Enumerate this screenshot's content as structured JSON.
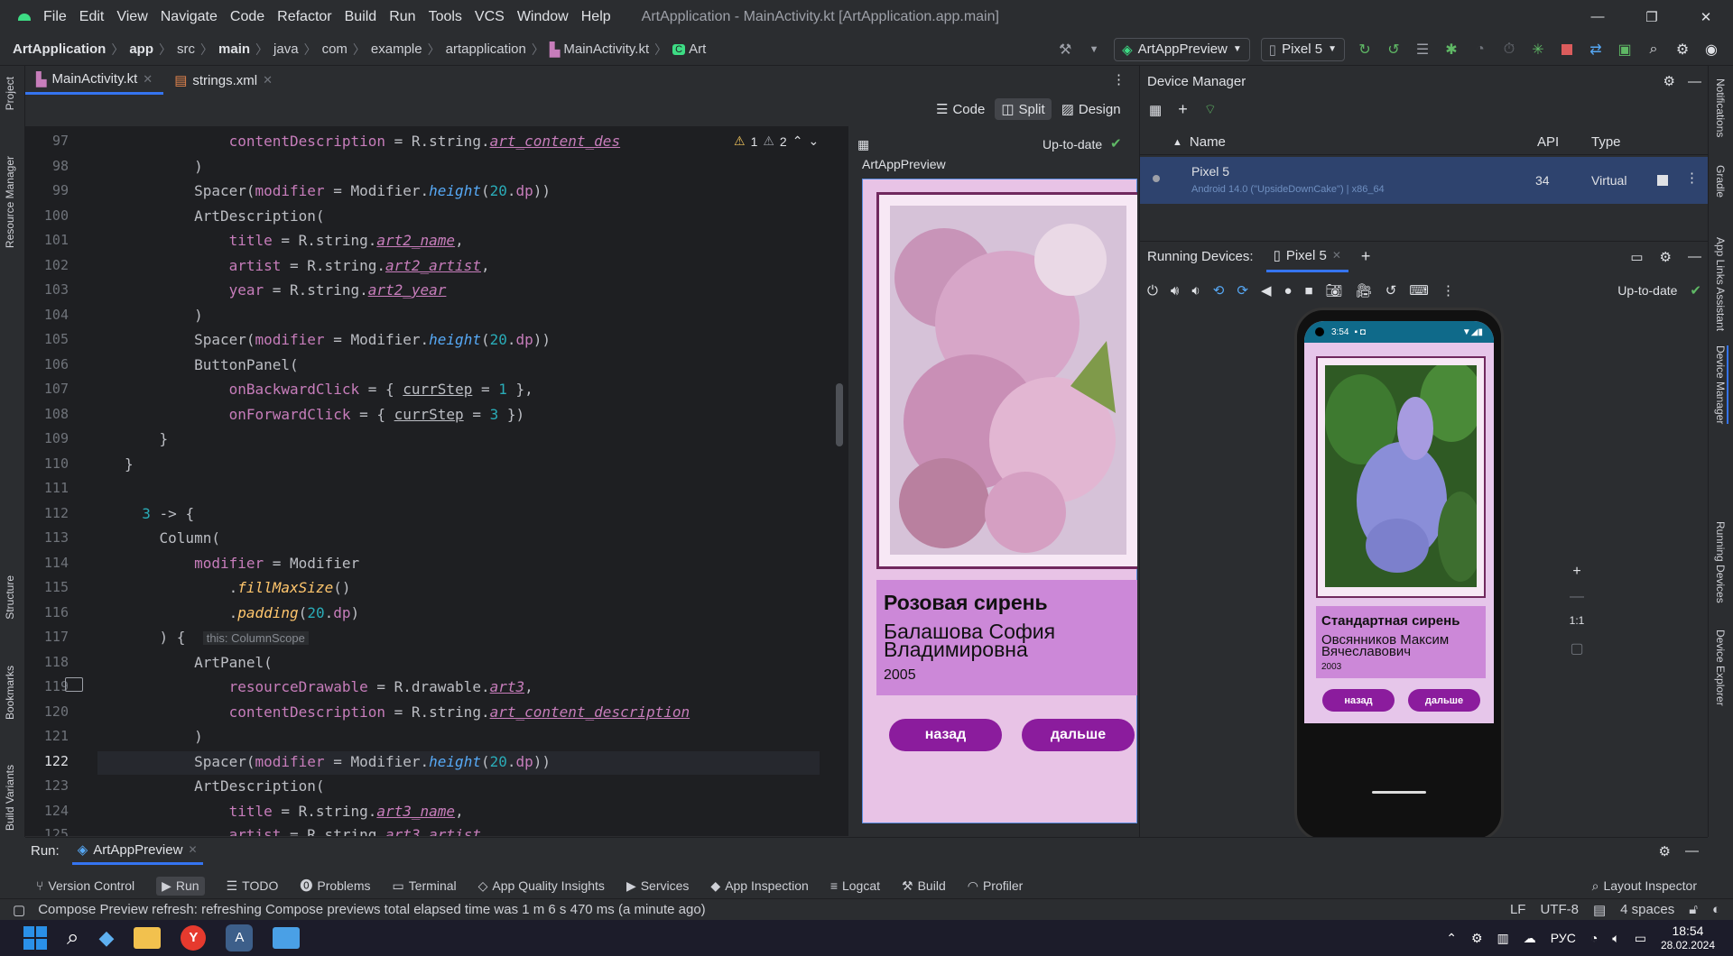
{
  "title": {
    "menu": [
      "File",
      "Edit",
      "View",
      "Navigate",
      "Code",
      "Refactor",
      "Build",
      "Run",
      "Tools",
      "VCS",
      "Window",
      "Help"
    ],
    "window_title": "ArtApplication - MainActivity.kt [ArtApplication.app.main]"
  },
  "breadcrumb": [
    "ArtApplication",
    "app",
    "src",
    "main",
    "java",
    "com",
    "example",
    "artapplication",
    "MainActivity.kt",
    "Art"
  ],
  "toolbar": {
    "config": "ArtAppPreview",
    "device": "Pixel 5"
  },
  "tabs": [
    "MainActivity.kt",
    "strings.xml"
  ],
  "viewmodes": [
    "Code",
    "Split",
    "Design"
  ],
  "inspections": {
    "warn1": "1",
    "warn2": "2"
  },
  "editor": {
    "line_numbers": [
      "97",
      "98",
      "99",
      "100",
      "101",
      "102",
      "103",
      "104",
      "105",
      "106",
      "107",
      "108",
      "109",
      "110",
      "111",
      "112",
      "113",
      "114",
      "115",
      "116",
      "117",
      "118",
      "119",
      "120",
      "121",
      "122",
      "123",
      "124",
      "125"
    ],
    "hint": "this: ColumnScope"
  },
  "preview": {
    "status": "Up-to-date",
    "label": "ArtAppPreview",
    "title": "Розовая сирень",
    "artist": "Балашова София Владимировна",
    "year": "2005",
    "back": "назад",
    "next": "дальше"
  },
  "device_manager": {
    "title": "Device Manager",
    "cols": [
      "Name",
      "API",
      "Type"
    ],
    "device_name": "Pixel 5",
    "device_sub": "Android 14.0 (\"UpsideDownCake\") | x86_64",
    "api": "34",
    "type": "Virtual"
  },
  "running": {
    "label": "Running Devices:",
    "tab": "Pixel 5",
    "status": "Up-to-date",
    "time": "3:54",
    "title": "Стандартная сирень",
    "artist": "Овсянников Максим Вячеславович",
    "year": "2003",
    "back": "назад",
    "next": "дальше",
    "zoom": "1:1"
  },
  "right_strip": [
    "Notifications",
    "Gradle",
    "App Links Assistant",
    "Device Manager",
    "Running Devices",
    "Device Explorer"
  ],
  "left_strip": [
    "Project",
    "Resource Manager",
    "Structure",
    "Bookmarks",
    "Build Variants"
  ],
  "run_bar": {
    "label": "Run:",
    "config": "ArtAppPreview"
  },
  "bottom_tabs": [
    "Version Control",
    "Run",
    "TODO",
    "Problems",
    "Terminal",
    "App Quality Insights",
    "Services",
    "App Inspection",
    "Logcat",
    "Build",
    "Profiler",
    "Layout Inspector"
  ],
  "status": {
    "message": "Compose Preview refresh: refreshing Compose previews total elapsed time was 1 m 6 s 470 ms (a minute ago)",
    "lf": "LF",
    "enc": "UTF-8",
    "indent": "4 spaces"
  },
  "taskbar": {
    "lang": "РУС",
    "time": "18:54",
    "date": "28.02.2024"
  }
}
